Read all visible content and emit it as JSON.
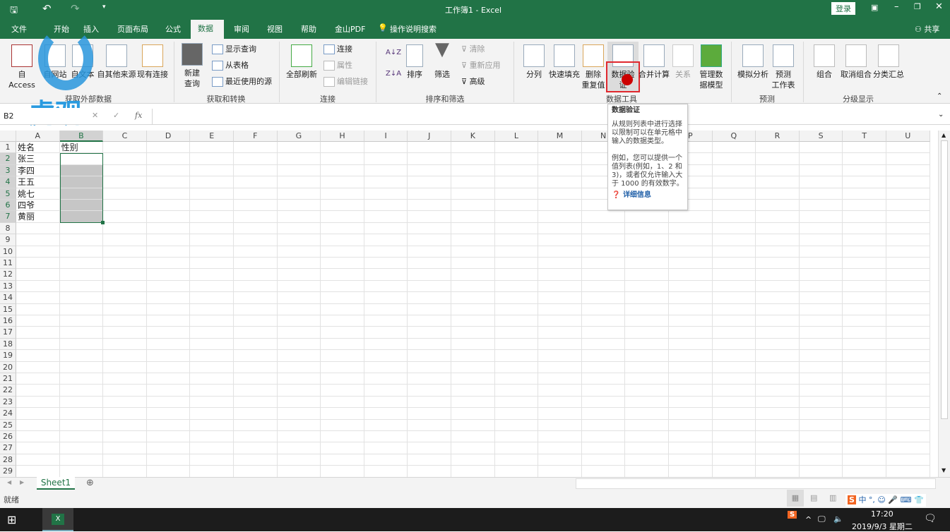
{
  "titlebar": {
    "title": "工作簿1  -  Excel",
    "login": "登录",
    "share": "共享"
  },
  "tabs": [
    "文件",
    "开始",
    "插入",
    "页面布局",
    "公式",
    "数据",
    "审阅",
    "视图",
    "帮助",
    "金山PDF",
    "操作说明搜索"
  ],
  "ribbon": {
    "groups": [
      "获取外部数据",
      "获取和转换",
      "连接",
      "排序和筛选",
      "数据工具",
      "预测",
      "分级显示"
    ],
    "external": [
      "自 Access",
      "自网站",
      "自文本",
      "自其他来源",
      "现有连接"
    ],
    "transform": {
      "new_query": "新建\n查询",
      "show_query": "显示查询",
      "from_table": "从表格",
      "recent": "最近使用的源"
    },
    "connections": {
      "refresh": "全部刷新",
      "conn": "连接",
      "props": "属性",
      "edit_links": "编辑链接"
    },
    "sort": {
      "sort": "排序",
      "filter": "筛选",
      "clear": "清除",
      "reapply": "重新应用",
      "advanced": "高级"
    },
    "tools": [
      "分列",
      "快速填充",
      "删除\n重复值",
      "数据验\n证",
      "合并计算",
      "关系",
      "管理数\n据模型"
    ],
    "forecast": [
      "模拟分析",
      "预测\n工作表"
    ],
    "outline": [
      "组合",
      "取消组合",
      "分类汇总"
    ]
  },
  "formula_bar": {
    "name_box": "B2",
    "fx": "fx",
    "value": ""
  },
  "columns": [
    "A",
    "B",
    "C",
    "D",
    "E",
    "F",
    "G",
    "H",
    "I",
    "J",
    "K",
    "L",
    "M",
    "N",
    "O",
    "P",
    "Q",
    "R",
    "S",
    "T",
    "U"
  ],
  "cells": {
    "A": [
      "姓名",
      "张三",
      "李四",
      "王五",
      "姚七",
      "四爷",
      "黄丽"
    ],
    "B": [
      "性别"
    ]
  },
  "tooltip": {
    "title": "数据验证",
    "body1": "从规则列表中进行选择以限制可以在单元格中输入的数据类型。",
    "body2": "例如，您可以提供一个值列表(例如，1、2 和 3)，或者仅允许输入大于 1000 的有效数字。",
    "link": "详细信息"
  },
  "sheet": {
    "tab": "Sheet1"
  },
  "status": {
    "ready": "就绪"
  },
  "taskbar": {
    "time": "17:20",
    "date": "2019/9/3 星期二",
    "ime": "中"
  },
  "watermark": "虎观",
  "colors": {
    "accent": "#217346",
    "highlight": "#e0282e"
  }
}
